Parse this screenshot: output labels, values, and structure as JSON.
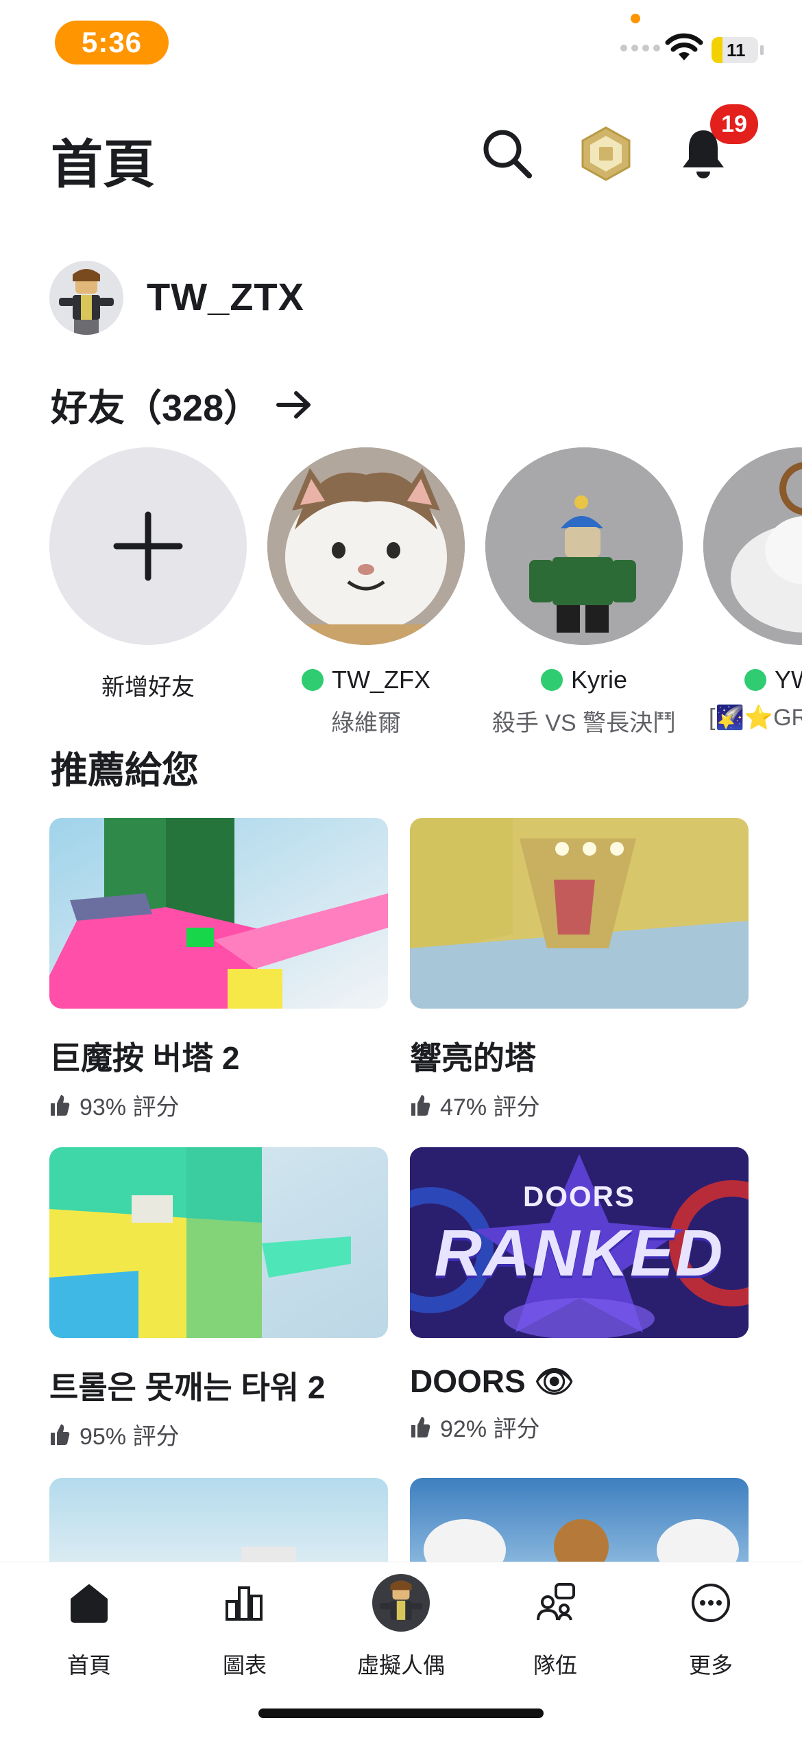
{
  "status_bar": {
    "time": "5:36",
    "battery": "11"
  },
  "header": {
    "title": "首頁",
    "notification_count": "19"
  },
  "profile": {
    "username": "TW_ZTX"
  },
  "friends": {
    "title": "好友（328）",
    "add_label": "新增好友",
    "items": [
      {
        "name": "TW_ZFX",
        "status": "綠維爾"
      },
      {
        "name": "Kyrie",
        "status": "殺手 VS 警長決鬥"
      },
      {
        "name": "YW",
        "status": "[🌠⭐GR"
      }
    ]
  },
  "recommended": {
    "title": "推薦給您",
    "games": [
      {
        "title": "巨魔按 버塔 2",
        "rating": "93% 評分"
      },
      {
        "title": "響亮的塔",
        "rating": "47% 評分"
      },
      {
        "title": "트롤은 못깨는 타워 2",
        "rating": "95% 評分"
      },
      {
        "title": "DOORS 👁",
        "rating": "92% 評分",
        "thumb_word_top": "DOORS",
        "thumb_word_main": "RANKED"
      }
    ]
  },
  "nav": {
    "items": [
      {
        "label": "首頁",
        "icon": "home-icon"
      },
      {
        "label": "圖表",
        "icon": "charts-icon"
      },
      {
        "label": "虛擬人偶",
        "icon": "avatar-icon"
      },
      {
        "label": "隊伍",
        "icon": "party-icon"
      },
      {
        "label": "更多",
        "icon": "more-icon"
      }
    ]
  }
}
